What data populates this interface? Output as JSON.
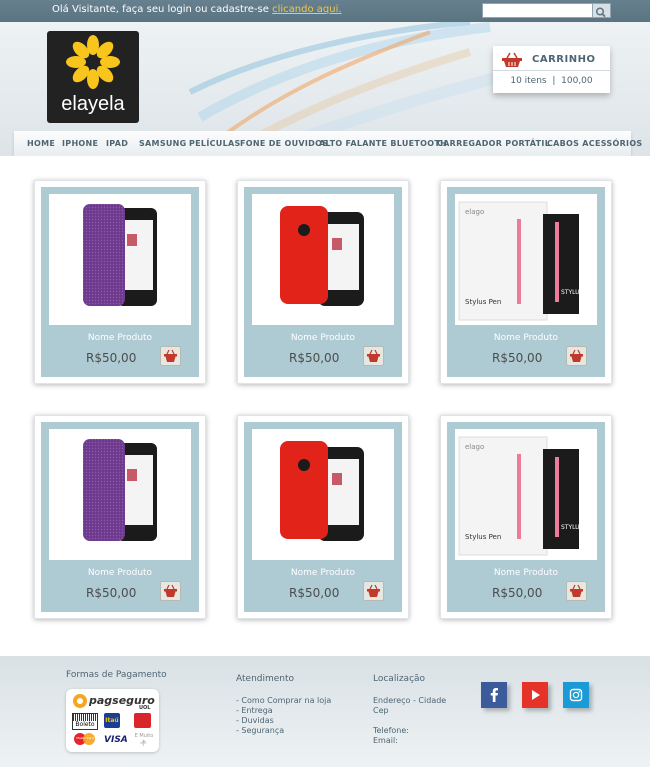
{
  "topbar": {
    "login_text": "Olá Visitante, faça seu login ou cadastre-se",
    "login_link": "clicando aqui.",
    "search_placeholder": ""
  },
  "brand": {
    "name": "elayela"
  },
  "cart": {
    "title": "CARRINHO",
    "items": "10 itens",
    "separator": "|",
    "total": "100,00"
  },
  "nav": {
    "items": [
      "HOME",
      "IPHONE",
      "IPAD",
      "SAMSUNG",
      "PELÍCULAS",
      "FONE DE OUVIDOS",
      "ALTO FALANTE BLUETOOTH",
      "CARREGADOR PORTÁTIL",
      "CABOS ACESSÓRIOS"
    ]
  },
  "products": [
    {
      "name": "Nome Produto",
      "price": "R$50,00",
      "image": "purple-case"
    },
    {
      "name": "Nome Produto",
      "price": "R$50,00",
      "image": "red-case"
    },
    {
      "name": "Nome Produto",
      "price": "R$50,00",
      "image": "stylus-pen"
    },
    {
      "name": "Nome Produto",
      "price": "R$50,00",
      "image": "purple-case"
    },
    {
      "name": "Nome Produto",
      "price": "R$50,00",
      "image": "red-case"
    },
    {
      "name": "Nome Produto",
      "price": "R$50,00",
      "image": "stylus-pen"
    }
  ],
  "stylus_box": {
    "brand": "elago",
    "label": "Stylus Pen",
    "side": "STYLUS"
  },
  "footer": {
    "payment_title": "Formas de Pagamento",
    "payment_brand": "pagseguro",
    "payment_sub": "UOL",
    "payment_methods": [
      "Boleto",
      "Itaú",
      "Bradesco",
      "MasterCard",
      "VISA",
      "E Muito +"
    ],
    "service_title": "Atendimento",
    "service_links": [
      "- Como Comprar na loja",
      "- Entrega",
      "- Duvidas",
      "- Segurança"
    ],
    "location_title": "Localização",
    "address_line": "Endereço - Cidade",
    "cep": "Cep",
    "phone_label": "Telefone:",
    "email_label": "Email:"
  },
  "social": [
    {
      "name": "facebook",
      "color": "#3b5b9a"
    },
    {
      "name": "youtube",
      "color": "#e5332a"
    },
    {
      "name": "instagram",
      "color": "#1a9ad6"
    }
  ],
  "colors": {
    "topbar": "#5e7786",
    "accent_link": "#f1c84a",
    "card_panel": "#aecad3",
    "nav_text": "#4e6573",
    "logo_yellow": "#f7c51c"
  }
}
